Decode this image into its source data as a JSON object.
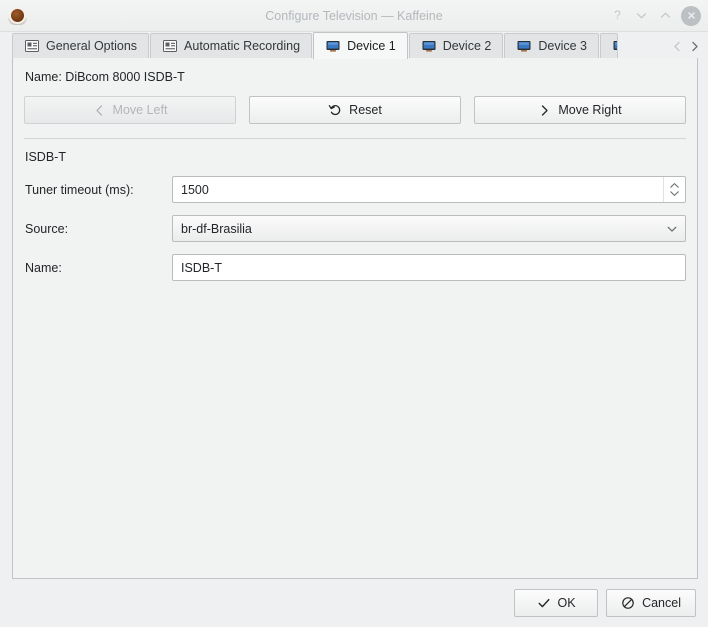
{
  "window": {
    "title": "Configure Television — Kaffeine",
    "app_icon": "kaffeine-coffee-cup-icon",
    "controls": {
      "help": "?",
      "minimize": "minimize",
      "maximize": "maximize",
      "close": "close"
    }
  },
  "tabs": {
    "items": [
      {
        "label": "General Options",
        "icon": "form-list-icon",
        "selected": false
      },
      {
        "label": "Automatic Recording",
        "icon": "form-list-icon",
        "selected": false
      },
      {
        "label": "Device 1",
        "icon": "television-icon",
        "selected": true
      },
      {
        "label": "Device 2",
        "icon": "television-icon",
        "selected": false
      },
      {
        "label": "Device 3",
        "icon": "television-icon",
        "selected": false
      },
      {
        "label": "",
        "icon": "television-icon",
        "selected": false
      }
    ],
    "scroll_left": "‹",
    "scroll_right": "›"
  },
  "page": {
    "device_name_line": "Name: DiBcom 8000 ISDB-T",
    "buttons": [
      {
        "label": "Move Left",
        "icon": "chevron-left-icon",
        "enabled": false
      },
      {
        "label": "Reset",
        "icon": "undo-icon",
        "enabled": true
      },
      {
        "label": "Move Right",
        "icon": "chevron-right-icon",
        "enabled": true
      }
    ],
    "group_label": "ISDB-T",
    "fields": {
      "tuner_timeout": {
        "label": "Tuner timeout (ms):",
        "value": "1500",
        "type": "spinbox"
      },
      "source": {
        "label": "Source:",
        "value": "br-df-Brasilia",
        "type": "combobox"
      },
      "name": {
        "label": "Name:",
        "value": "ISDB-T",
        "type": "textbox"
      }
    }
  },
  "footer": {
    "ok": {
      "label": "OK",
      "icon": "check-icon"
    },
    "cancel": {
      "label": "Cancel",
      "icon": "no-entry-icon"
    }
  },
  "colors": {
    "dialog_bg": "#eff0f1",
    "page_bg": "#f1f2f2",
    "selected_tab_bg": "#f6f7f7",
    "tab_bg": "#e2e4e5",
    "border": "#c0c4c7",
    "text": "#232629",
    "disabled_text": "#b2b6b9",
    "title_text": "#b3b8bb",
    "tv_icon_screen": "#3b78c3"
  }
}
